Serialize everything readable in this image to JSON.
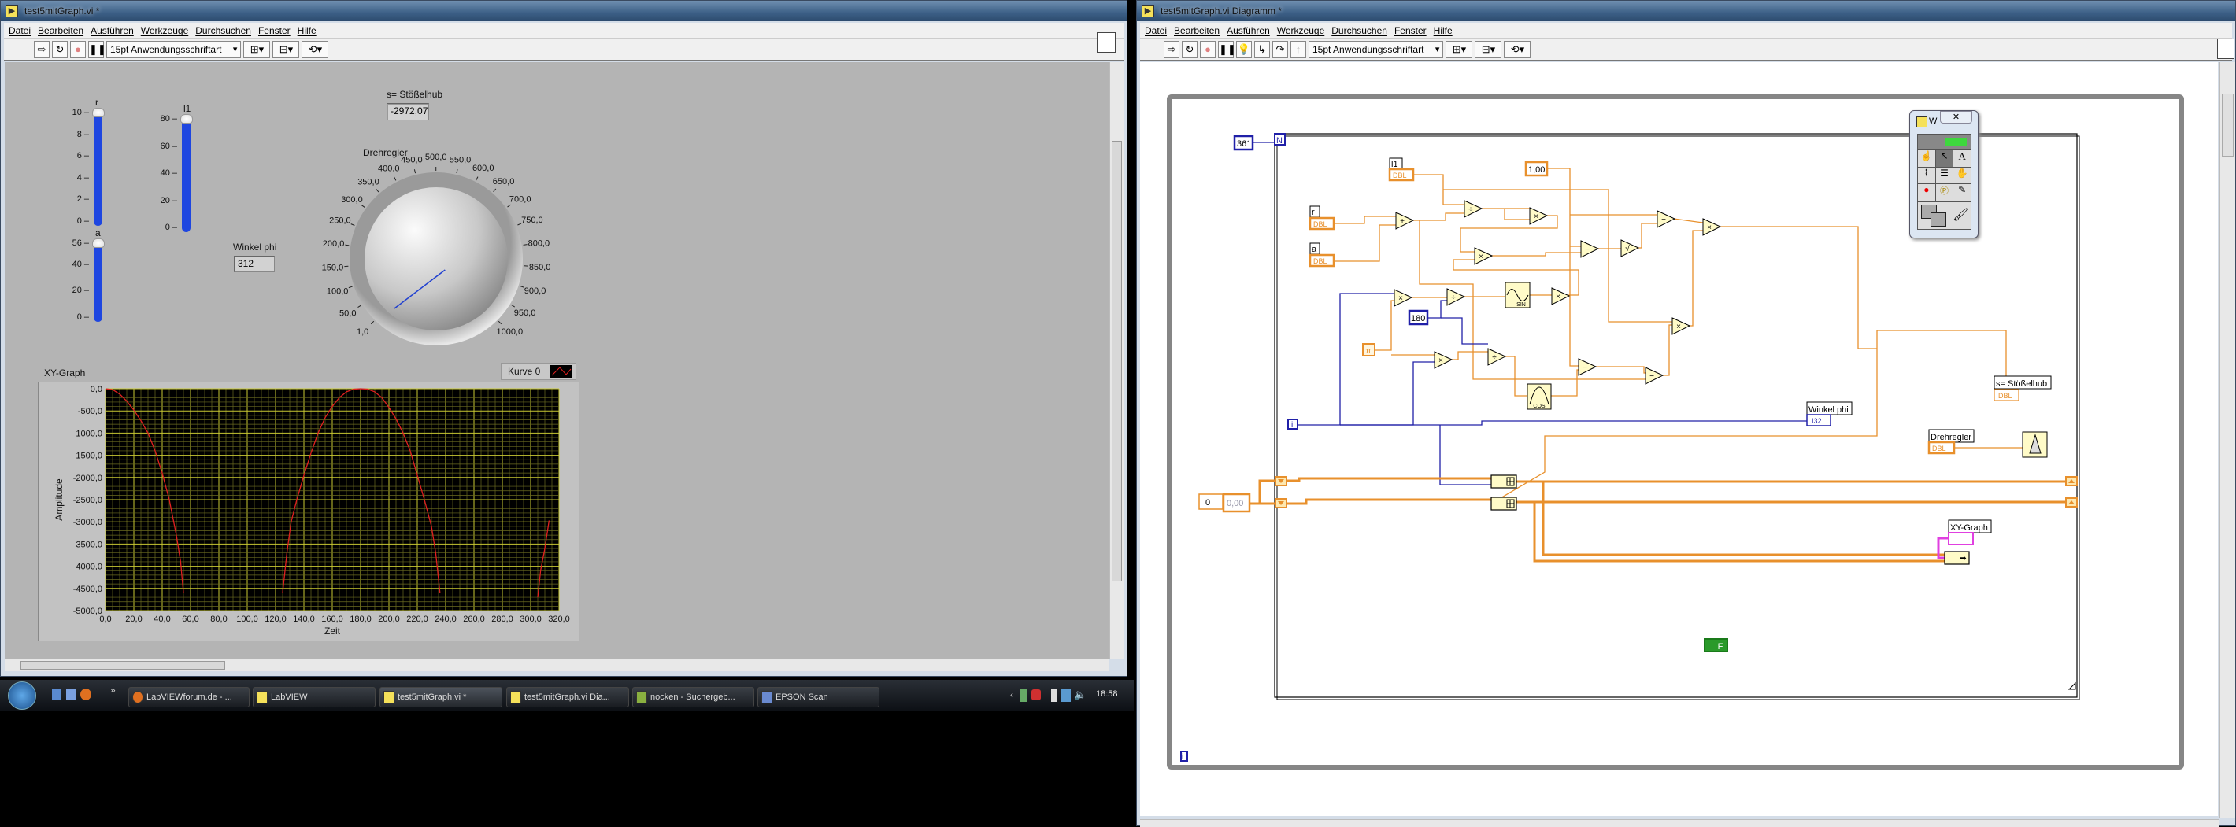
{
  "front_panel": {
    "title": "test5mitGraph.vi *",
    "menu": [
      "Datei",
      "Bearbeiten",
      "Ausführen",
      "Werkzeuge",
      "Durchsuchen",
      "Fenster",
      "Hilfe"
    ],
    "font_select": "15pt Anwendungsschriftart",
    "sliders": [
      {
        "label": "r",
        "min": 0,
        "max": 10,
        "value": 10,
        "ticks": [
          "0",
          "2",
          "4",
          "6",
          "8",
          "10"
        ]
      },
      {
        "label": "l1",
        "min": 0,
        "max": 80,
        "value": 80,
        "ticks": [
          "0",
          "20",
          "40",
          "60",
          "80"
        ]
      },
      {
        "label": "a",
        "min": 0,
        "max": 56,
        "value": 56,
        "ticks": [
          "0",
          "20",
          "40",
          "56"
        ]
      }
    ],
    "stoesselhub": {
      "label": "s= Stößelhub",
      "value": "-2972,07"
    },
    "winkel_phi": {
      "label": "Winkel phi",
      "value": "312"
    },
    "knob": {
      "label": "Drehregler",
      "min": 1,
      "max": 1000,
      "value": 1,
      "ticks": [
        "1,0",
        "50,0",
        "100,0",
        "150,0",
        "200,0",
        "250,0",
        "300,0",
        "350,0",
        "400,0",
        "450,0",
        "500,0",
        "550,0",
        "600,0",
        "650,0",
        "700,0",
        "750,0",
        "800,0",
        "850,0",
        "900,0",
        "950,0",
        "1000,0"
      ]
    },
    "graph": {
      "label": "XY-Graph",
      "legend": "Kurve 0"
    }
  },
  "chart_data": {
    "type": "line",
    "title": "XY-Graph",
    "xlabel": "Zeit",
    "ylabel": "Amplitude",
    "xlim": [
      0,
      320
    ],
    "ylim": [
      -5000,
      0
    ],
    "xticks": [
      "0,0",
      "20,0",
      "40,0",
      "60,0",
      "80,0",
      "100,0",
      "120,0",
      "140,0",
      "160,0",
      "180,0",
      "200,0",
      "220,0",
      "240,0",
      "260,0",
      "280,0",
      "300,0",
      "320,0"
    ],
    "yticks": [
      "0,0",
      "-500,0",
      "-1000,0",
      "-1500,0",
      "-2000,0",
      "-2500,0",
      "-3000,0",
      "-3500,0",
      "-4000,0",
      "-4500,0",
      "-5000,0"
    ],
    "grid": true,
    "legend_position": "top-right",
    "series": [
      {
        "name": "Kurve 0",
        "color": "#e02020",
        "segments": [
          [
            [
              0,
              0
            ],
            [
              5,
              -20
            ],
            [
              10,
              -120
            ],
            [
              15,
              -280
            ],
            [
              20,
              -480
            ],
            [
              25,
              -720
            ],
            [
              30,
              -1000
            ],
            [
              35,
              -1400
            ],
            [
              40,
              -1900
            ],
            [
              45,
              -2500
            ],
            [
              50,
              -3300
            ],
            [
              53,
              -3900
            ],
            [
              55,
              -4600
            ]
          ],
          [
            [
              125,
              -4600
            ],
            [
              128,
              -3700
            ],
            [
              131,
              -3000
            ],
            [
              135,
              -2500
            ],
            [
              140,
              -1950
            ],
            [
              145,
              -1450
            ],
            [
              150,
              -1000
            ],
            [
              155,
              -650
            ],
            [
              160,
              -400
            ],
            [
              165,
              -200
            ],
            [
              170,
              -70
            ],
            [
              175,
              -10
            ],
            [
              180,
              0
            ],
            [
              185,
              -10
            ],
            [
              190,
              -70
            ],
            [
              195,
              -200
            ],
            [
              200,
              -420
            ],
            [
              205,
              -680
            ],
            [
              210,
              -1000
            ],
            [
              215,
              -1400
            ],
            [
              220,
              -1950
            ],
            [
              225,
              -2500
            ],
            [
              230,
              -3100
            ],
            [
              233,
              -3700
            ],
            [
              236,
              -4600
            ]
          ],
          [
            [
              305,
              -4700
            ],
            [
              307,
              -4100
            ],
            [
              310,
              -3600
            ],
            [
              313,
              -2970
            ]
          ]
        ]
      }
    ]
  },
  "diagram": {
    "title": "test5mitGraph.vi Diagramm *",
    "menu": [
      "Datei",
      "Bearbeiten",
      "Ausführen",
      "Werkzeuge",
      "Durchsuchen",
      "Fenster",
      "Hilfe"
    ],
    "font_select": "15pt Anwendungsschriftart",
    "loop_count": "361",
    "loop_n": "N",
    "iter": "i",
    "const_one": "1,00",
    "const_180": "180",
    "const_pi": "π",
    "init_index": "0",
    "init_value": "0,00",
    "false_const": "F",
    "primitives": [
      "+",
      "÷",
      "×",
      "×",
      "−",
      "√",
      "−",
      "×",
      "×",
      "÷",
      "×",
      "×",
      "÷",
      "−",
      "−",
      "×"
    ],
    "sin": "SIN",
    "cos": "COS",
    "terminals": [
      {
        "label": "l1",
        "type": "DBL"
      },
      {
        "label": "r",
        "type": "DBL"
      },
      {
        "label": "a",
        "type": "DBL"
      },
      {
        "label": "Winkel phi",
        "type": "I32"
      },
      {
        "label": "s= Stößelhub",
        "type": "DBL"
      },
      {
        "label": "Drehregler",
        "type": "DBL"
      },
      {
        "label": "XY-Graph",
        "type": "XY"
      }
    ],
    "colors": {
      "dbl": "#e8902c",
      "i32": "#2020a8",
      "cluster": "#e040e0"
    }
  },
  "tools_palette": {
    "title": "W"
  },
  "taskbar": {
    "items": [
      "LabVIEWforum.de - ...",
      "LabVIEW",
      "test5mitGraph.vi *",
      "test5mitGraph.vi Dia...",
      "nocken - Suchergeb...",
      "EPSON Scan"
    ],
    "clock": "18:58"
  }
}
